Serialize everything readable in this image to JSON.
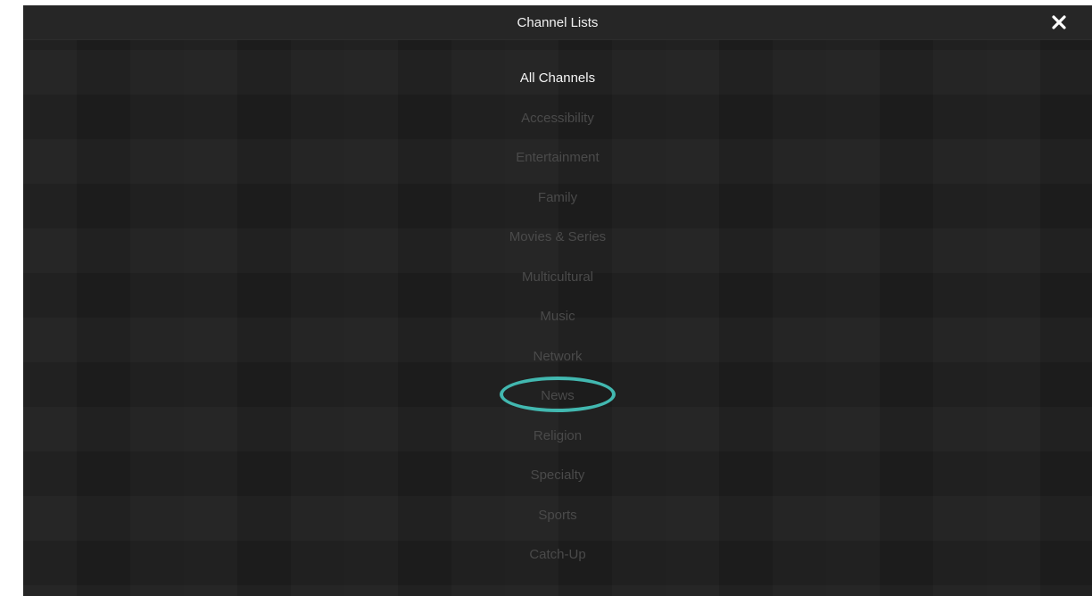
{
  "header": {
    "title": "Channel Lists",
    "close_icon": "close-icon"
  },
  "menu": {
    "items": [
      {
        "label": "All Channels",
        "active": true
      },
      {
        "label": "Accessibility"
      },
      {
        "label": "Entertainment"
      },
      {
        "label": "Family"
      },
      {
        "label": "Movies & Series"
      },
      {
        "label": "Multicultural"
      },
      {
        "label": "Music"
      },
      {
        "label": "Network"
      },
      {
        "label": "News",
        "highlighted": true
      },
      {
        "label": "Religion"
      },
      {
        "label": "Specialty"
      },
      {
        "label": "Sports"
      },
      {
        "label": "Catch-Up"
      }
    ]
  },
  "colors": {
    "background": "#1e1e1e",
    "active_text": "#f4f4f4",
    "inactive_text": "#4a4a4a",
    "highlight_ring": "#42b8b0"
  }
}
